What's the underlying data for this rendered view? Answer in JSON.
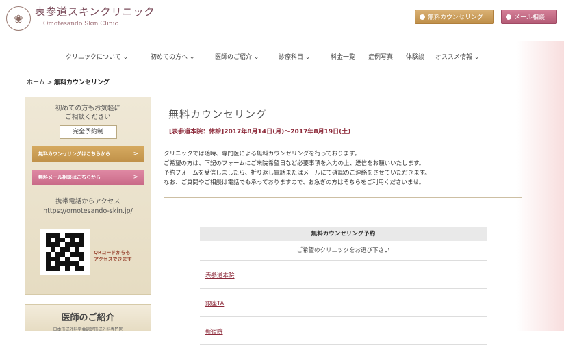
{
  "header": {
    "logo_jp": "表参道スキンクリニック",
    "logo_en": "Omotesando Skin Clinic",
    "btn_counsel": "無料カウンセリング",
    "btn_mail": "メール相談"
  },
  "nav": {
    "items": [
      {
        "label": "クリニックについて"
      },
      {
        "label": "初めての方へ"
      },
      {
        "label": "医師のご紹介"
      },
      {
        "label": "診療科目"
      },
      {
        "label": "料金一覧"
      },
      {
        "label": "症例写真"
      },
      {
        "label": "体験談"
      },
      {
        "label": "オススメ情報"
      }
    ]
  },
  "breadcrumb": {
    "home": "ホーム",
    "sep": ">",
    "current": "無料カウンセリング"
  },
  "sidebar": {
    "intro_line1": "初めての方もお気軽に",
    "intro_line2": "ご相談ください",
    "reservation": "完全予約制",
    "counsel_btn": "無料カウンセリングはこちらから",
    "mail_btn": "無料メール相談はこちらから",
    "arrow": ">",
    "access_line1": "携帯電話からアクセス",
    "access_line2": "https://omotesando-skin.jp/",
    "qr_line1": "QRコードからも",
    "qr_line2": "アクセスできます",
    "doctor_title": "医師のご紹介",
    "doctor_sub": "日本形成外科学会認定形成外科専門医"
  },
  "main": {
    "title": "無料カウンセリング",
    "closed_notice": "[表参道本院：休診]2017年8月14日(月)～2017年8月19日(土)",
    "desc_line1": "クリニックでは随時、専門医による無料カウンセリングを行っております。",
    "desc_line2": "ご希望の方は、下記のフォームにご来院希望日など必要事項を入力の上、送信をお願いいたします。",
    "desc_line3": "予約フォームを受信しましたら、折り返し電話またはメールにて確認のご連絡をさせていただきます。",
    "desc_line4": "なお、ご質問やご相談は電話でも承っておりますので、お急ぎの方はそちらをご利用くださいませ。"
  },
  "form": {
    "title": "無料カウンセリング予約",
    "subtitle": "ご希望のクリニックをお選び下さい",
    "clinics": [
      "表参道本院",
      "銀座TA",
      "新宿院"
    ]
  }
}
